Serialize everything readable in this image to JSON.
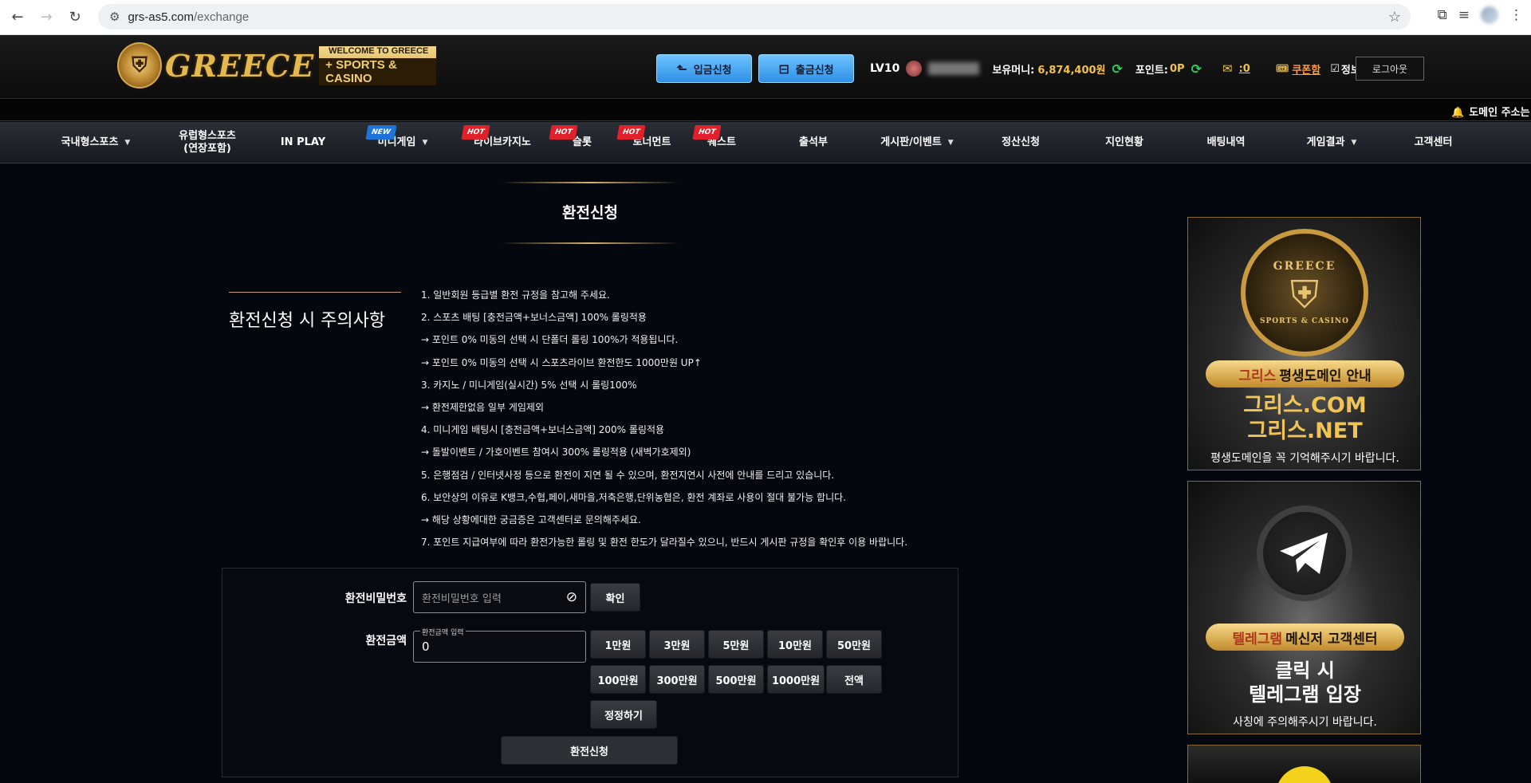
{
  "browser": {
    "url_host": "grs-as5.com",
    "url_path": "/exchange"
  },
  "logo": {
    "text": "GREECE",
    "badge_line1": "WELCOME TO GREECE",
    "badge_line2": "+ SPORTS & CASINO"
  },
  "header": {
    "deposit_label": "입금신청",
    "withdraw_label": "출금신청",
    "level": "LV10",
    "money_label": "보유머니:",
    "money_value": "6,874,400원",
    "point_label": "포인트:",
    "point_value": "0P",
    "mail_count": "0",
    "coupon_label": "쿠폰함",
    "profile_label": "정보수정",
    "logout_label": "로그아웃"
  },
  "ticker": {
    "text": "도메인 주소는"
  },
  "nav": {
    "items": [
      {
        "label": "국내형스포츠",
        "caret": true
      },
      {
        "label": "유럽형스포츠\n(연장포함)",
        "caret": false
      },
      {
        "label": "IN PLAY",
        "caret": false
      },
      {
        "label": "미니게임",
        "caret": true,
        "badge": "NEW"
      },
      {
        "label": "라이브카지노",
        "caret": false,
        "badge": "HOT"
      },
      {
        "label": "슬롯",
        "caret": false,
        "badge": "HOT"
      },
      {
        "label": "토너먼트",
        "caret": false,
        "badge": "HOT"
      },
      {
        "label": "퀘스트",
        "caret": false,
        "badge": "HOT"
      },
      {
        "label": "출석부",
        "caret": false
      },
      {
        "label": "게시판/이벤트",
        "caret": true
      },
      {
        "label": "정산신청",
        "caret": false
      },
      {
        "label": "지인현황",
        "caret": false
      },
      {
        "label": "배팅내역",
        "caret": false
      },
      {
        "label": "게임결과",
        "caret": true
      },
      {
        "label": "고객센터",
        "caret": false
      }
    ]
  },
  "page": {
    "title": "환전신청",
    "notice_heading": "환전신청 시 주의사항",
    "notices": [
      "1. 일반회원 등급별 환전 규정을 참고해 주세요.",
      "2. 스포츠 배팅 [충전금액+보너스금액] 100% 롤링적용",
      "→ 포인트 0% 미동의 선택 시 단폴더 롤링 100%가 적용됩니다.",
      "→ 포인트 0% 미동의 선택 시 스포츠라이브 환전한도 1000만원 UP↑",
      "3. 카지노 / 미니게임(실시간) 5% 선택 시 롤링100%",
      "→ 환전제한없음 일부 게임제외",
      "4. 미니게임 배팅시 [충전금액+보너스금액] 200% 롤링적용",
      "→ 돌발이벤트 / 가호이벤트 참여시 300% 롤링적용 (새벽가호제외)",
      "5. 은행점검 / 인터넷사정 등으로 환전이 지연 될 수 있으며, 환전지연시 사전에 안내를 드리고 있습니다.",
      "6. 보안상의 이유로 K뱅크,수협,페이,새마을,저축은행,단위농협은, 환전 계좌로 사용이 절대 불가능 합니다.",
      "→ 해당 상황에대한 궁금증은 고객센터로 문의해주세요.",
      "7. 포인트 지급여부에 따라 환전가능한 롤링 및 환전 한도가 달라질수 있으니, 반드시 게시판 규정을 확인후 이용 바랍니다."
    ]
  },
  "form": {
    "password_label": "환전비밀번호",
    "password_placeholder": "환전비밀번호 입력",
    "confirm_label": "확인",
    "amount_label": "환전금액",
    "amount_float_label": "환전금액 입력",
    "amount_value": "0",
    "quick_amounts": [
      "1만원",
      "3만원",
      "5만원",
      "10만원",
      "50만원",
      "100만원",
      "300만원",
      "500만원",
      "1000만원",
      "전액"
    ],
    "reset_label": "정정하기",
    "submit_label": "환전신청"
  },
  "banners": {
    "domain": {
      "emblem_top": "GREECE",
      "emblem_bottom": "SPORTS & CASINO",
      "pill_accent": "그리스",
      "pill_rest": "평생도메인 안내",
      "line1": "그리스.COM",
      "line2": "그리스.NET",
      "caption": "평생도메인을 꼭 기억해주시기 바랍니다."
    },
    "telegram": {
      "pill_accent": "텔레그램",
      "pill_rest": "메신저 고객센터",
      "line1": "클릭 시",
      "line2": "텔레그램 입장",
      "caption": "사칭에 주의해주시기 바랍니다."
    }
  },
  "colors": {
    "accent_gold": "#f4c247",
    "button_blue": "#2d8fe6",
    "hot_red": "#e0202a",
    "new_blue": "#1e73d8"
  }
}
